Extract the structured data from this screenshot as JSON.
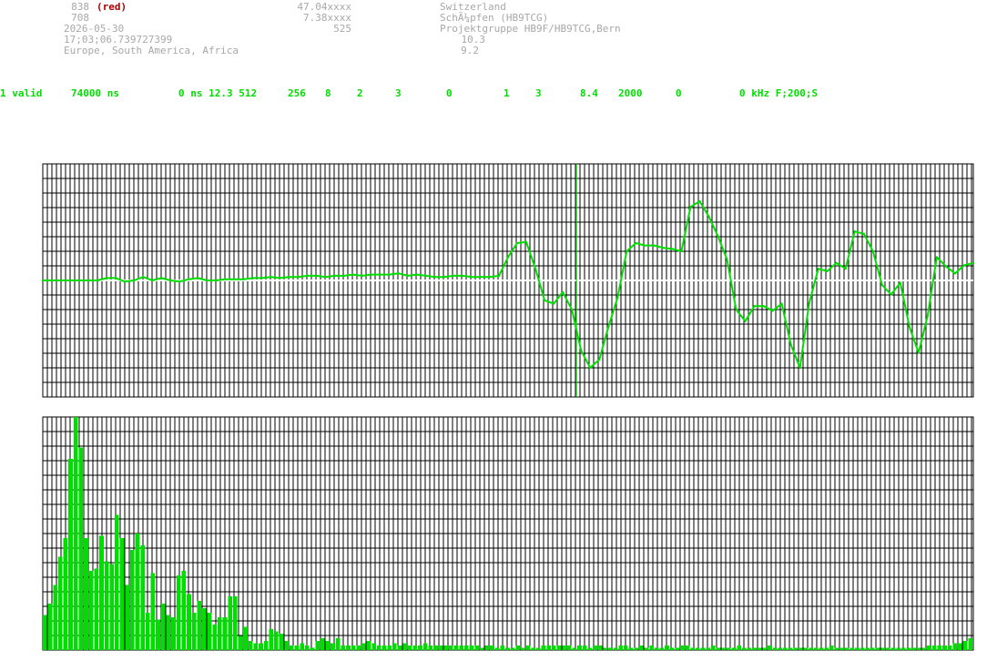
{
  "header": {
    "id": "838",
    "id_tag": "(red)",
    "val2": "708",
    "date": "2026-05-30",
    "time": "17;03;06.739727399",
    "regions": "Europe, South America, Africa",
    "lat": "47.04xxxx",
    "lon": "7.38xxxx",
    "num": "525",
    "country": "Switzerland",
    "place": "SchÃ¼pfen (HB9TCG)",
    "group": "Projektgruppe HB9F/HB9TCG,Bern",
    "v1": "10.3",
    "v2": "9.2"
  },
  "status_fields": [
    "1 valid",
    "74000 ns",
    "0 ns 12.3 512",
    "256",
    "8",
    "2",
    "3",
    "0",
    "1",
    "3",
    "8.4",
    "2000",
    "0",
    "0 kHz F;200;S"
  ],
  "colors": {
    "trace": "#00dd00",
    "grid": "#000000",
    "header_text": "#a8a8a8",
    "tag": "#aa0000",
    "baseline": "#ffffff"
  },
  "chart_data": [
    {
      "type": "line",
      "title": "",
      "x": [
        0,
        10,
        20,
        30,
        40,
        50,
        60,
        70,
        80,
        90,
        100,
        110,
        120,
        130,
        140,
        150,
        160,
        170,
        180,
        190,
        200,
        210,
        220,
        230,
        240,
        250,
        260,
        270,
        280,
        290,
        300,
        310,
        320,
        330,
        340,
        350,
        360,
        370,
        380,
        390,
        400,
        410,
        420,
        430,
        440,
        450,
        460,
        470,
        480,
        490,
        500,
        510,
        520,
        530,
        540,
        550,
        560,
        570,
        580,
        590,
        600,
        610,
        620,
        630,
        640,
        650,
        660,
        670,
        680,
        690,
        700,
        710,
        720,
        730,
        740,
        750,
        760,
        770,
        780,
        790,
        800,
        810,
        820,
        830,
        840,
        850,
        860,
        870,
        880,
        890,
        900,
        910,
        920,
        930,
        940,
        950,
        960,
        970,
        980,
        990,
        1000,
        1010,
        1020
      ],
      "y": [
        0.0,
        0.0,
        0.0,
        0.0,
        0.0,
        0.0,
        0.0,
        0.02,
        0.02,
        -0.01,
        0.0,
        0.03,
        0.0,
        0.02,
        0.0,
        -0.01,
        0.01,
        0.02,
        0.0,
        0.0,
        0.01,
        0.01,
        0.01,
        0.02,
        0.02,
        0.03,
        0.02,
        0.03,
        0.03,
        0.04,
        0.04,
        0.03,
        0.04,
        0.04,
        0.05,
        0.04,
        0.05,
        0.05,
        0.05,
        0.06,
        0.04,
        0.05,
        0.04,
        0.03,
        0.03,
        0.04,
        0.04,
        0.03,
        0.03,
        0.03,
        0.04,
        0.2,
        0.32,
        0.33,
        0.1,
        -0.17,
        -0.2,
        -0.1,
        -0.25,
        -0.6,
        -0.75,
        -0.68,
        -0.4,
        -0.15,
        0.25,
        0.32,
        0.3,
        0.3,
        0.28,
        0.27,
        0.25,
        0.63,
        0.68,
        0.55,
        0.38,
        0.18,
        -0.25,
        -0.35,
        -0.22,
        -0.22,
        -0.26,
        -0.2,
        -0.55,
        -0.75,
        -0.2,
        0.1,
        0.08,
        0.15,
        0.1,
        0.42,
        0.4,
        0.25,
        -0.04,
        -0.12,
        -0.02,
        -0.4,
        -0.62,
        -0.3,
        0.2,
        0.12,
        0.06,
        0.13,
        0.15
      ],
      "ylim": [
        -1,
        1
      ],
      "marker_x": 585,
      "grid": true
    },
    {
      "type": "bar",
      "title": "",
      "values": [
        0.15,
        0.2,
        0.28,
        0.4,
        0.48,
        0.82,
        1.0,
        0.87,
        0.48,
        0.34,
        0.35,
        0.49,
        0.38,
        0.37,
        0.58,
        0.48,
        0.28,
        0.43,
        0.5,
        0.45,
        0.16,
        0.33,
        0.13,
        0.2,
        0.15,
        0.14,
        0.32,
        0.34,
        0.24,
        0.16,
        0.21,
        0.18,
        0.16,
        0.11,
        0.14,
        0.14,
        0.23,
        0.23,
        0.06,
        0.1,
        0.04,
        0.03,
        0.03,
        0.04,
        0.09,
        0.08,
        0.07,
        0.04,
        0.02,
        0.02,
        0.03,
        0.02,
        0.01,
        0.04,
        0.05,
        0.04,
        0.03,
        0.05,
        0.02,
        0.02,
        0.02,
        0.02,
        0.03,
        0.04,
        0.03,
        0.02,
        0.02,
        0.02,
        0.03,
        0.02,
        0.03,
        0.02,
        0.02,
        0.02,
        0.03,
        0.02,
        0.02,
        0.02,
        0.02,
        0.02,
        0.02,
        0.02,
        0.02,
        0.02,
        0.02,
        0.01,
        0.02,
        0.02,
        0.01,
        0.02,
        0.01,
        0.01,
        0.02,
        0.01,
        0.02,
        0.01,
        0.01,
        0.02,
        0.02,
        0.02,
        0.02,
        0.02,
        0.02,
        0.01,
        0.02,
        0.02,
        0.01,
        0.02,
        0.02,
        0.01,
        0.01,
        0.01,
        0.02,
        0.02,
        0.01,
        0.01,
        0.02,
        0.01,
        0.02,
        0.01,
        0.01,
        0.02,
        0.01,
        0.01,
        0.02,
        0.02,
        0.01,
        0.01,
        0.01,
        0.01,
        0.02,
        0.01,
        0.01,
        0.01,
        0.01,
        0.02,
        0.01,
        0.01,
        0.01,
        0.01,
        0.01,
        0.02,
        0.01,
        0.01,
        0.01,
        0.01,
        0.01,
        0.01,
        0.01,
        0.01,
        0.01,
        0.01,
        0.01,
        0.02,
        0.01,
        0.01,
        0.01,
        0.01,
        0.01,
        0.01,
        0.01,
        0.01,
        0.01,
        0.01,
        0.01,
        0.01,
        0.01,
        0.01,
        0.01,
        0.01,
        0.01,
        0.01,
        0.02,
        0.02,
        0.02,
        0.02,
        0.02,
        0.03,
        0.03,
        0.04,
        0.05
      ],
      "ylim": [
        0,
        1
      ],
      "grid": true
    }
  ]
}
